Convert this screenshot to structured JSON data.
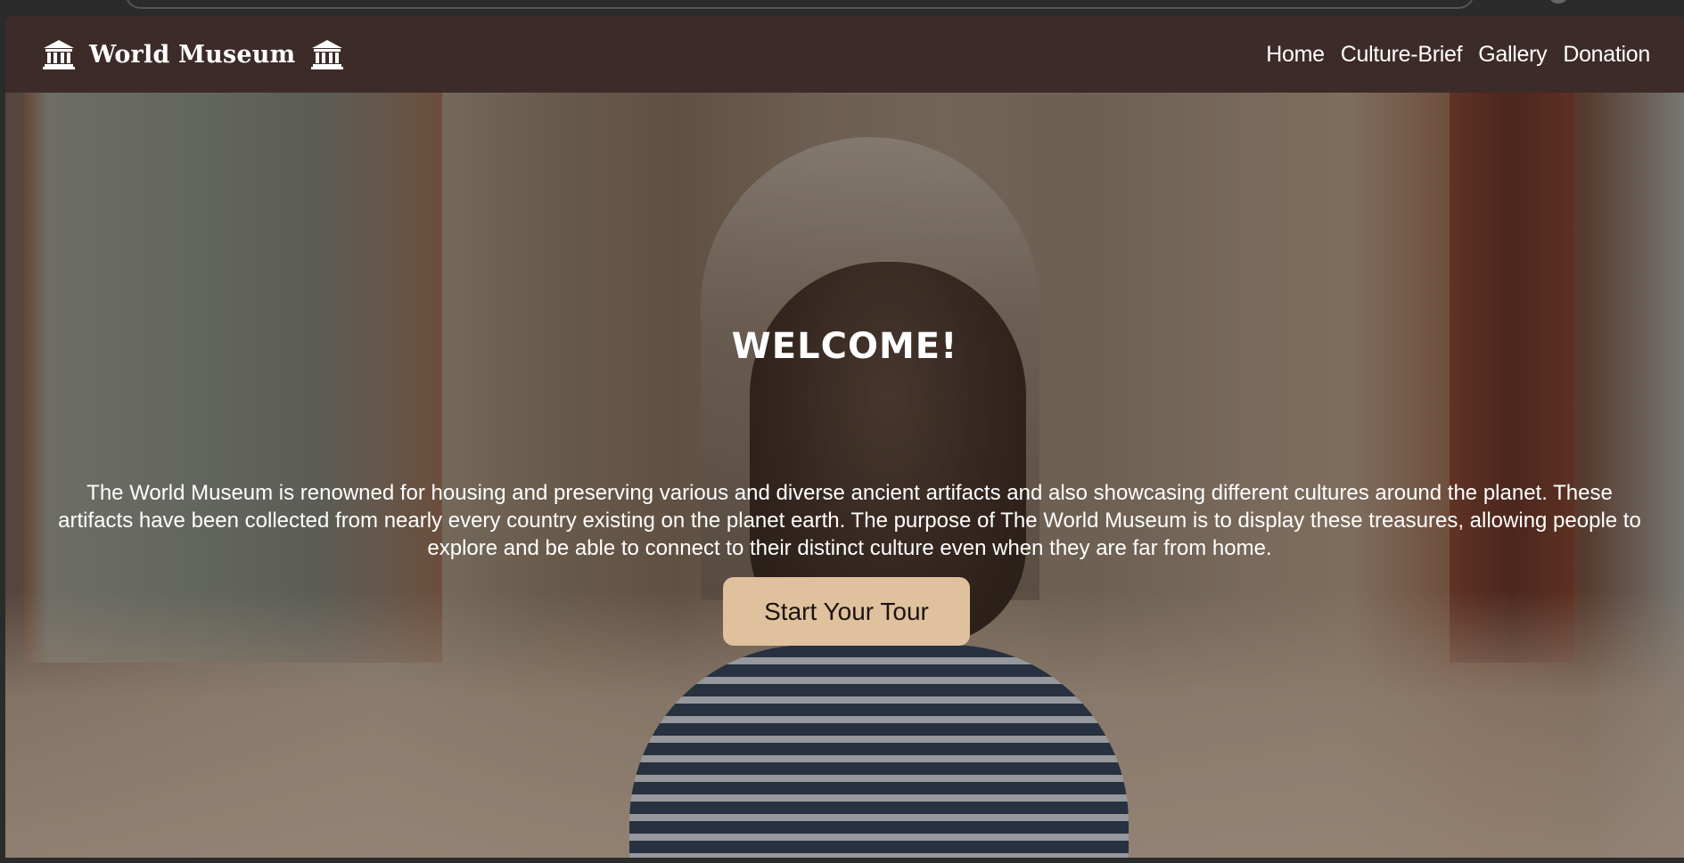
{
  "brand": {
    "name": "World Museum",
    "icon_left": "museum-icon",
    "icon_right": "museum-icon"
  },
  "nav": {
    "items": [
      {
        "label": "Home"
      },
      {
        "label": "Culture-Brief"
      },
      {
        "label": "Gallery"
      },
      {
        "label": "Donation"
      }
    ]
  },
  "hero": {
    "heading": "WELCOME!",
    "text": "The World Museum is renowned for housing and preserving various and diverse ancient artifacts and also showcasing different cultures around the planet. These artifacts have been collected from nearly every country existing on the planet earth. The purpose of The World Museum is to display these treasures, allowing people to explore and be able to connect to their distinct culture even when they are far from home.",
    "button_label": "Start Your Tour"
  },
  "colors": {
    "navbar": "#3d2b29",
    "button": "#dfc19d",
    "text": "#ffffff"
  }
}
